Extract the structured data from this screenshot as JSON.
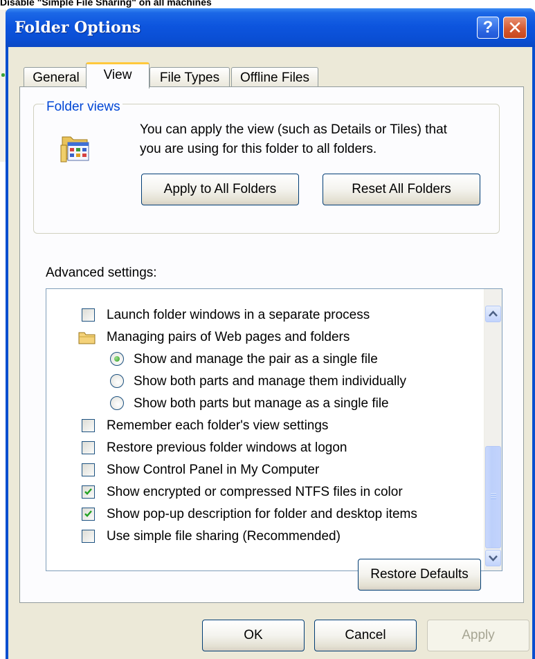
{
  "page_caption": "Disable \"Simple File Sharing\" on all machines",
  "window": {
    "title": "Folder Options",
    "help_glyph": "?",
    "close_glyph": "✕"
  },
  "tabs": [
    {
      "label": "General",
      "active": false
    },
    {
      "label": "View",
      "active": true
    },
    {
      "label": "File Types",
      "active": false
    },
    {
      "label": "Offline Files",
      "active": false
    }
  ],
  "folder_views": {
    "group_title": "Folder views",
    "description_line1": "You can apply the view (such as Details or Tiles) that",
    "description_line2": "you are using for this folder to all folders.",
    "apply_button": "Apply to All Folders",
    "reset_button": "Reset All Folders",
    "icon": "folder-view-icon"
  },
  "advanced": {
    "label": "Advanced settings:",
    "items": [
      {
        "type": "checkbox",
        "text": "Launch folder windows in a separate process",
        "checked": false
      },
      {
        "type": "folder",
        "text": "Managing pairs of Web pages and folders"
      },
      {
        "type": "radio",
        "text": "Show and manage the pair as a single file",
        "selected": true
      },
      {
        "type": "radio",
        "text": "Show both parts and manage them individually",
        "selected": false
      },
      {
        "type": "radio",
        "text": "Show both parts but manage as a single file",
        "selected": false
      },
      {
        "type": "checkbox",
        "text": "Remember each folder's view settings",
        "checked": false
      },
      {
        "type": "checkbox",
        "text": "Restore previous folder windows at logon",
        "checked": false
      },
      {
        "type": "checkbox",
        "text": "Show Control Panel in My Computer",
        "checked": false
      },
      {
        "type": "checkbox",
        "text": "Show encrypted or compressed NTFS files in color",
        "checked": true
      },
      {
        "type": "checkbox",
        "text": "Show pop-up description for folder and desktop items",
        "checked": true
      },
      {
        "type": "checkbox",
        "text": "Use simple file sharing (Recommended)",
        "checked": false
      }
    ],
    "restore_defaults": "Restore Defaults"
  },
  "footer": {
    "ok": "OK",
    "cancel": "Cancel",
    "apply": "Apply"
  },
  "colors": {
    "title_bar": "#0a4ed4",
    "dialog_face": "#ece9d8",
    "group_title": "#0046d5",
    "active_tab_highlight": "#ffc83c",
    "close_button": "#d55a32"
  }
}
